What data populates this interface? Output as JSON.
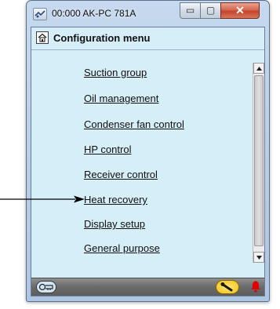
{
  "window": {
    "title": "00:000 AK-PC 781A",
    "minimize_glyph": "▭",
    "maximize_glyph": "▢",
    "close_glyph": "✕"
  },
  "header": {
    "title": "Configuration menu",
    "icon": "home-icon"
  },
  "menu": {
    "items": [
      {
        "label": "Suction group"
      },
      {
        "label": "Oil management"
      },
      {
        "label": "Condenser fan control"
      },
      {
        "label": "HP control"
      },
      {
        "label": "Receiver control"
      },
      {
        "label": "Heat recovery"
      },
      {
        "label": "Display setup"
      },
      {
        "label": "General purpose"
      }
    ],
    "highlighted_index": 5
  },
  "statusbar": {
    "icons": [
      "login-icon",
      "service-wrench-icon",
      "alarm-bell-icon"
    ]
  },
  "colors": {
    "content_bg": "#d6eef8",
    "statusbar_bg": "#6a6a6a",
    "alarm": "#e00000",
    "service_button": "#f0c21b"
  }
}
